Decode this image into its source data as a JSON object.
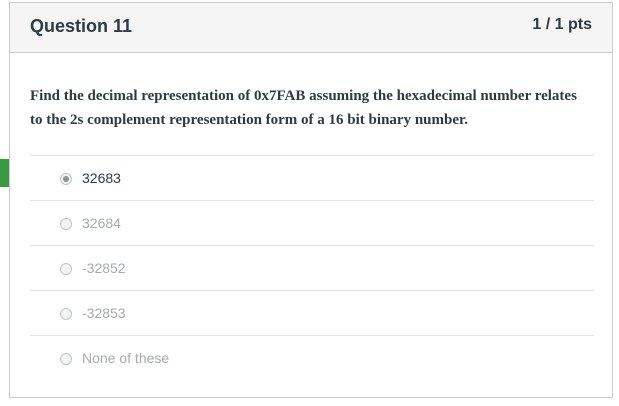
{
  "question": {
    "title": "Question 11",
    "points": "1 / 1 pts",
    "text": "Find the decimal representation of 0x7FAB assuming the hexadecimal number relates to the 2s complement representation form of a 16 bit binary number."
  },
  "answers": [
    {
      "label": "32683",
      "selected": true
    },
    {
      "label": "32684",
      "selected": false
    },
    {
      "label": "-32852",
      "selected": false
    },
    {
      "label": "-32853",
      "selected": false
    },
    {
      "label": "None of these",
      "selected": false
    }
  ],
  "colors": {
    "correct_marker": "#3a9a3f",
    "text": "#2d3b45",
    "muted_text": "#a5abaf",
    "header_bg": "#f5f5f5",
    "border": "#c7cdd1"
  },
  "icons": {
    "correct_marker": "correct-answer-arrow-icon"
  }
}
